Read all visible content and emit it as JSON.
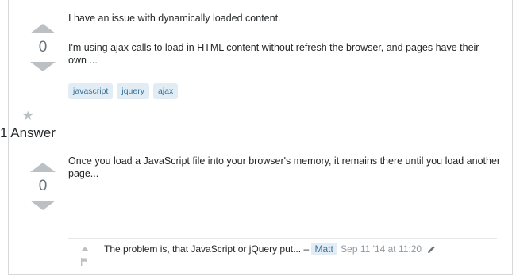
{
  "question": {
    "vote_count": "0",
    "title": "I have an issue with dynamically loaded content.",
    "excerpt": "I'm using ajax calls to load in HTML content without refresh the browser, and pages have their own ...",
    "tags": [
      "javascript",
      "jquery",
      "ajax"
    ]
  },
  "answers_header": "1 Answer",
  "answer": {
    "vote_count": "0",
    "text": "Once you load a JavaScript file into your browser's memory, it remains there until you load another page..."
  },
  "comment": {
    "text": "The problem is, that JavaScript or jQuery put...",
    "dash": "–",
    "user": "Matt",
    "date": "Sep 11 '14 at 11:20"
  }
}
